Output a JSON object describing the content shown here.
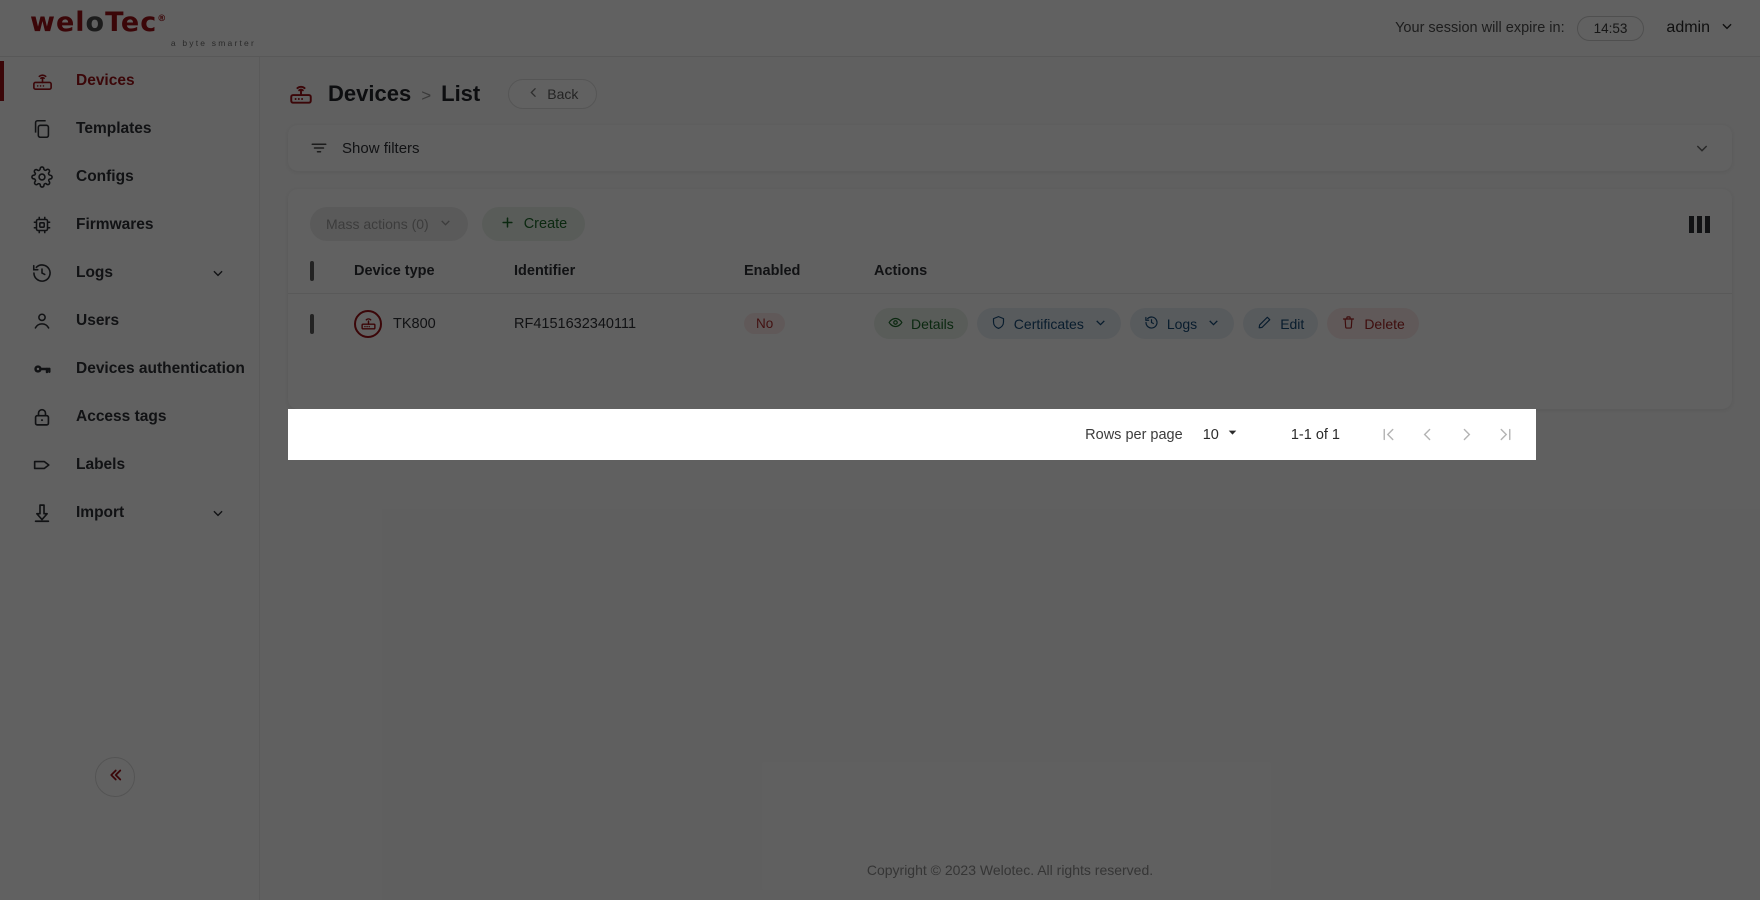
{
  "header": {
    "logo_main": "weLOTec",
    "logo_part1": "wel",
    "logo_part2": "o",
    "logo_part3": "Tec",
    "logo_registered": "®",
    "logo_tagline": "a byte smarter",
    "session_label": "Your session will expire in:",
    "session_time": "14:53",
    "user_name": "admin"
  },
  "sidebar": {
    "items": [
      {
        "label": "Devices",
        "icon": "router-icon",
        "active": true,
        "expandable": false
      },
      {
        "label": "Templates",
        "icon": "copy-icon",
        "active": false,
        "expandable": false
      },
      {
        "label": "Configs",
        "icon": "gear-icon",
        "active": false,
        "expandable": false
      },
      {
        "label": "Firmwares",
        "icon": "chip-icon",
        "active": false,
        "expandable": false
      },
      {
        "label": "Logs",
        "icon": "history-icon",
        "active": false,
        "expandable": true
      },
      {
        "label": "Users",
        "icon": "user-icon",
        "active": false,
        "expandable": false
      },
      {
        "label": "Devices authentication",
        "icon": "key-icon",
        "active": false,
        "expandable": false
      },
      {
        "label": "Access tags",
        "icon": "lock-icon",
        "active": false,
        "expandable": false
      },
      {
        "label": "Labels",
        "icon": "tag-icon",
        "active": false,
        "expandable": false
      },
      {
        "label": "Import",
        "icon": "download-icon",
        "active": false,
        "expandable": true
      }
    ],
    "collapse_icon": "chevron-double-left-icon"
  },
  "page": {
    "breadcrumb_root": "Devices",
    "breadcrumb_sep": ">",
    "breadcrumb_current": "List",
    "back_label": "Back",
    "page_icon": "router-icon"
  },
  "filters": {
    "label": "Show filters",
    "icon": "filter-icon",
    "caret": "chevron-down-icon"
  },
  "toolbar": {
    "mass_actions_label": "Mass actions (0)",
    "create_label": "Create",
    "column_settings_icon": "columns-icon"
  },
  "table": {
    "columns": [
      "Device type",
      "Identifier",
      "Enabled",
      "Actions"
    ],
    "rows": [
      {
        "device_type": "TK800",
        "identifier": "RF4151632340111",
        "enabled": "No",
        "actions": [
          {
            "label": "Details",
            "icon": "eye-icon",
            "color": "green",
            "dropdown": false
          },
          {
            "label": "Certificates",
            "icon": "shield-icon",
            "color": "blue",
            "dropdown": true
          },
          {
            "label": "Logs",
            "icon": "history-icon",
            "color": "blue",
            "dropdown": true
          },
          {
            "label": "Edit",
            "icon": "pencil-icon",
            "color": "blue",
            "dropdown": false
          },
          {
            "label": "Delete",
            "icon": "trash-icon",
            "color": "red",
            "dropdown": false
          }
        ]
      }
    ]
  },
  "pagination": {
    "rows_per_page_label": "Rows per page",
    "rows_per_page_value": "10",
    "range_label": "1-1 of 1",
    "first_icon": "first-page-icon",
    "prev_icon": "prev-page-icon",
    "next_icon": "next-page-icon",
    "last_icon": "last-page-icon"
  },
  "footer": {
    "copyright": "Copyright © 2023 Welotec. All rights reserved."
  },
  "colors": {
    "brand_red": "#9b1016",
    "green": "#1d6a2b",
    "blue": "#174a77",
    "danger": "#a32222",
    "overlay": "rgba(0,0,0,0.62)"
  }
}
